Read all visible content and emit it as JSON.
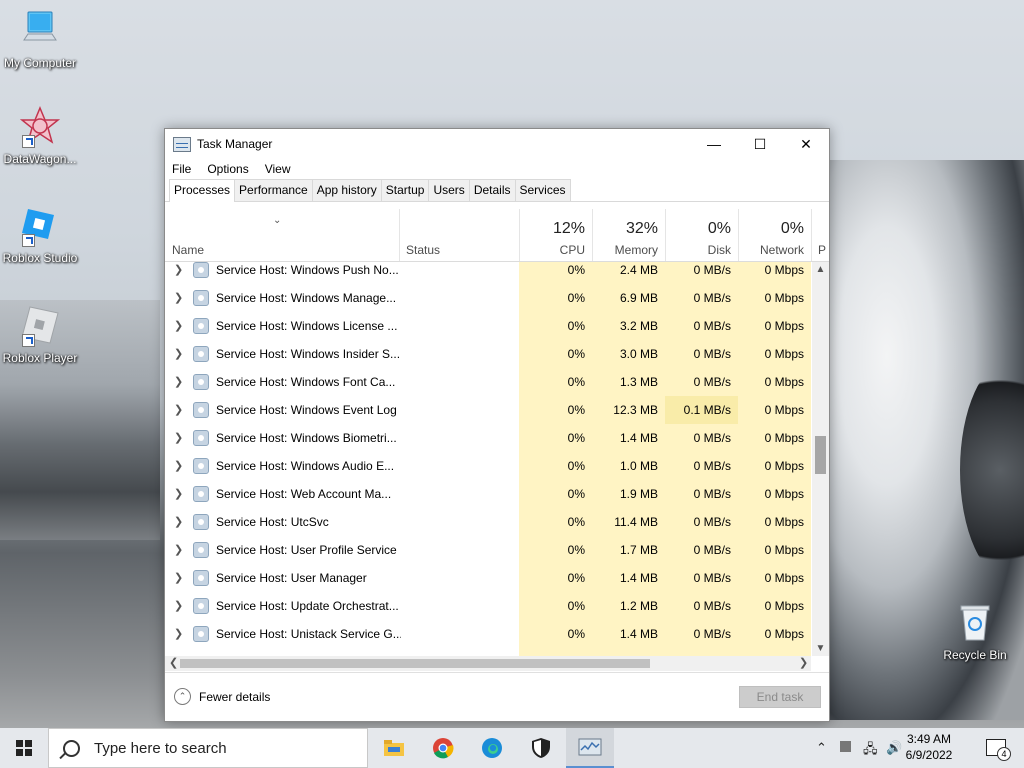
{
  "desktop": {
    "icons": [
      {
        "label": "My Computer"
      },
      {
        "label": "DataWagon..."
      },
      {
        "label": "Roblox Studio"
      },
      {
        "label": "Roblox Player"
      },
      {
        "label": "Recycle Bin"
      }
    ]
  },
  "window": {
    "title": "Task Manager",
    "controls": {
      "minimize": "—",
      "maximize": "☐",
      "close": "✕"
    }
  },
  "menu": [
    "File",
    "Options",
    "View"
  ],
  "tabs": [
    "Processes",
    "Performance",
    "App history",
    "Startup",
    "Users",
    "Details",
    "Services"
  ],
  "active_tab": "Processes",
  "columns": {
    "name": "Name",
    "status": "Status",
    "cpu": {
      "pct": "12%",
      "label": "CPU"
    },
    "memory": {
      "pct": "32%",
      "label": "Memory"
    },
    "disk": {
      "pct": "0%",
      "label": "Disk"
    },
    "network": {
      "pct": "0%",
      "label": "Network"
    },
    "extra": "P"
  },
  "processes": [
    {
      "name": "Service Host: Windows Push No...",
      "cpu": "0%",
      "memory": "2.4 MB",
      "disk": "0 MB/s",
      "network": "0 Mbps"
    },
    {
      "name": "Service Host: Windows Manage...",
      "cpu": "0%",
      "memory": "6.9 MB",
      "disk": "0 MB/s",
      "network": "0 Mbps"
    },
    {
      "name": "Service Host: Windows License ...",
      "cpu": "0%",
      "memory": "3.2 MB",
      "disk": "0 MB/s",
      "network": "0 Mbps"
    },
    {
      "name": "Service Host: Windows Insider S...",
      "cpu": "0%",
      "memory": "3.0 MB",
      "disk": "0 MB/s",
      "network": "0 Mbps"
    },
    {
      "name": "Service Host: Windows Font Ca...",
      "cpu": "0%",
      "memory": "1.3 MB",
      "disk": "0 MB/s",
      "network": "0 Mbps"
    },
    {
      "name": "Service Host: Windows Event Log",
      "cpu": "0%",
      "memory": "12.3 MB",
      "disk": "0.1 MB/s",
      "network": "0 Mbps"
    },
    {
      "name": "Service Host: Windows Biometri...",
      "cpu": "0%",
      "memory": "1.4 MB",
      "disk": "0 MB/s",
      "network": "0 Mbps"
    },
    {
      "name": "Service Host: Windows Audio E...",
      "cpu": "0%",
      "memory": "1.0 MB",
      "disk": "0 MB/s",
      "network": "0 Mbps"
    },
    {
      "name": "Service Host: Web Account Ma...",
      "cpu": "0%",
      "memory": "1.9 MB",
      "disk": "0 MB/s",
      "network": "0 Mbps"
    },
    {
      "name": "Service Host: UtcSvc",
      "cpu": "0%",
      "memory": "11.4 MB",
      "disk": "0 MB/s",
      "network": "0 Mbps"
    },
    {
      "name": "Service Host: User Profile Service",
      "cpu": "0%",
      "memory": "1.7 MB",
      "disk": "0 MB/s",
      "network": "0 Mbps"
    },
    {
      "name": "Service Host: User Manager",
      "cpu": "0%",
      "memory": "1.4 MB",
      "disk": "0 MB/s",
      "network": "0 Mbps"
    },
    {
      "name": "Service Host: Update Orchestrat...",
      "cpu": "0%",
      "memory": "1.2 MB",
      "disk": "0 MB/s",
      "network": "0 Mbps"
    },
    {
      "name": "Service Host: Unistack Service G...",
      "cpu": "0%",
      "memory": "1.4 MB",
      "disk": "0 MB/s",
      "network": "0 Mbps"
    }
  ],
  "footer": {
    "fewer_details": "Fewer details",
    "end_task": "End task"
  },
  "taskbar": {
    "search_placeholder": "Type here to search",
    "apps": [
      "file-explorer-icon",
      "chrome-icon",
      "edge-icon",
      "security-icon",
      "task-manager-icon"
    ],
    "time": "3:49 AM",
    "date": "6/9/2022",
    "notification_count": "4"
  },
  "colors": {
    "heat_light": "#fff4c4",
    "heat_medium": "#f9eca9",
    "accent": "#5a8fd0"
  }
}
